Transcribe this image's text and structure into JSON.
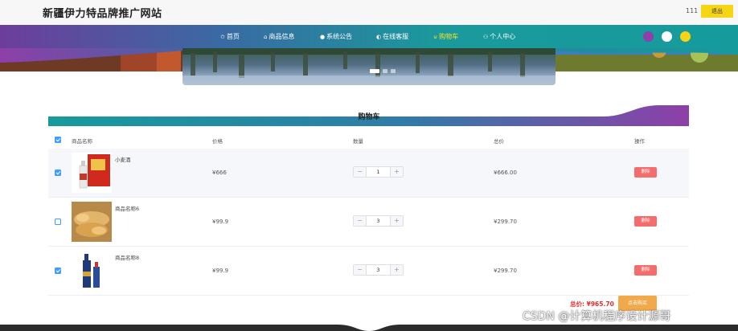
{
  "header": {
    "site_title": "新疆伊力特品牌推广网站",
    "user_id": "111",
    "logout_label": "退出"
  },
  "nav": {
    "items": [
      {
        "label": "首页",
        "icon": "star-icon",
        "glyph": "✩"
      },
      {
        "label": "商品信息",
        "icon": "home-icon",
        "glyph": "⌂"
      },
      {
        "label": "系统公告",
        "icon": "circle-icon",
        "glyph": "●"
      },
      {
        "label": "在线客服",
        "icon": "headset-icon",
        "glyph": "◐"
      },
      {
        "label": "购物车",
        "icon": "cart-icon",
        "glyph": "⊍"
      },
      {
        "label": "个人中心",
        "icon": "user-icon",
        "glyph": "⚇"
      }
    ],
    "active": "购物车",
    "theme_colors": [
      "#8e3fa8",
      "#ffffff",
      "#f5d514"
    ]
  },
  "carousel": {
    "active_slide": 1,
    "slide_count": 3
  },
  "cart": {
    "title": "购物车",
    "columns": [
      "商品名称",
      "价格",
      "数量",
      "总价",
      "操作"
    ],
    "select_all": true,
    "rows": [
      {
        "name": "小麦酒",
        "price": "¥666",
        "qty": "1",
        "total": "¥666.00",
        "checked": true,
        "delete_label": "删除",
        "image": "red-gift-box-liquor"
      },
      {
        "name": "商品名称6",
        "price": "¥99.9",
        "qty": "3",
        "total": "¥299.70",
        "checked": false,
        "delete_label": "删除",
        "image": "rolled-pastry"
      },
      {
        "name": "商品名称8",
        "price": "¥99.9",
        "qty": "3",
        "total": "¥299.70",
        "checked": true,
        "delete_label": "删除",
        "image": "blue-bottle-liquor"
      }
    ],
    "total_label": "总价:",
    "total_value": "¥965.70",
    "buy_label": "点击购买"
  },
  "watermark": "CSDN @计算机程序设计源哥"
}
